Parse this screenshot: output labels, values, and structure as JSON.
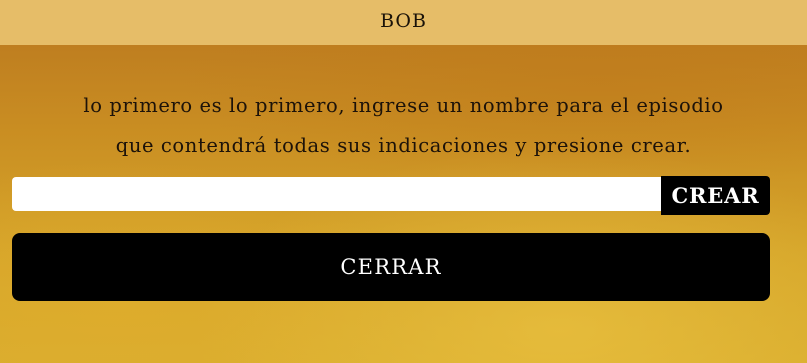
{
  "header": {
    "title": "BOB"
  },
  "instructions": {
    "line1": "lo primero es lo primero, ingrese un nombre para el episodio",
    "line2": "que contendrá todas sus indicaciones y presione crear."
  },
  "episode_form": {
    "name_value": "",
    "create_label": "CREAR"
  },
  "close_label": "CERRAR",
  "colors": {
    "header_bg": "#e6bd68",
    "button_bg": "#000000",
    "button_text": "#ffffff"
  }
}
